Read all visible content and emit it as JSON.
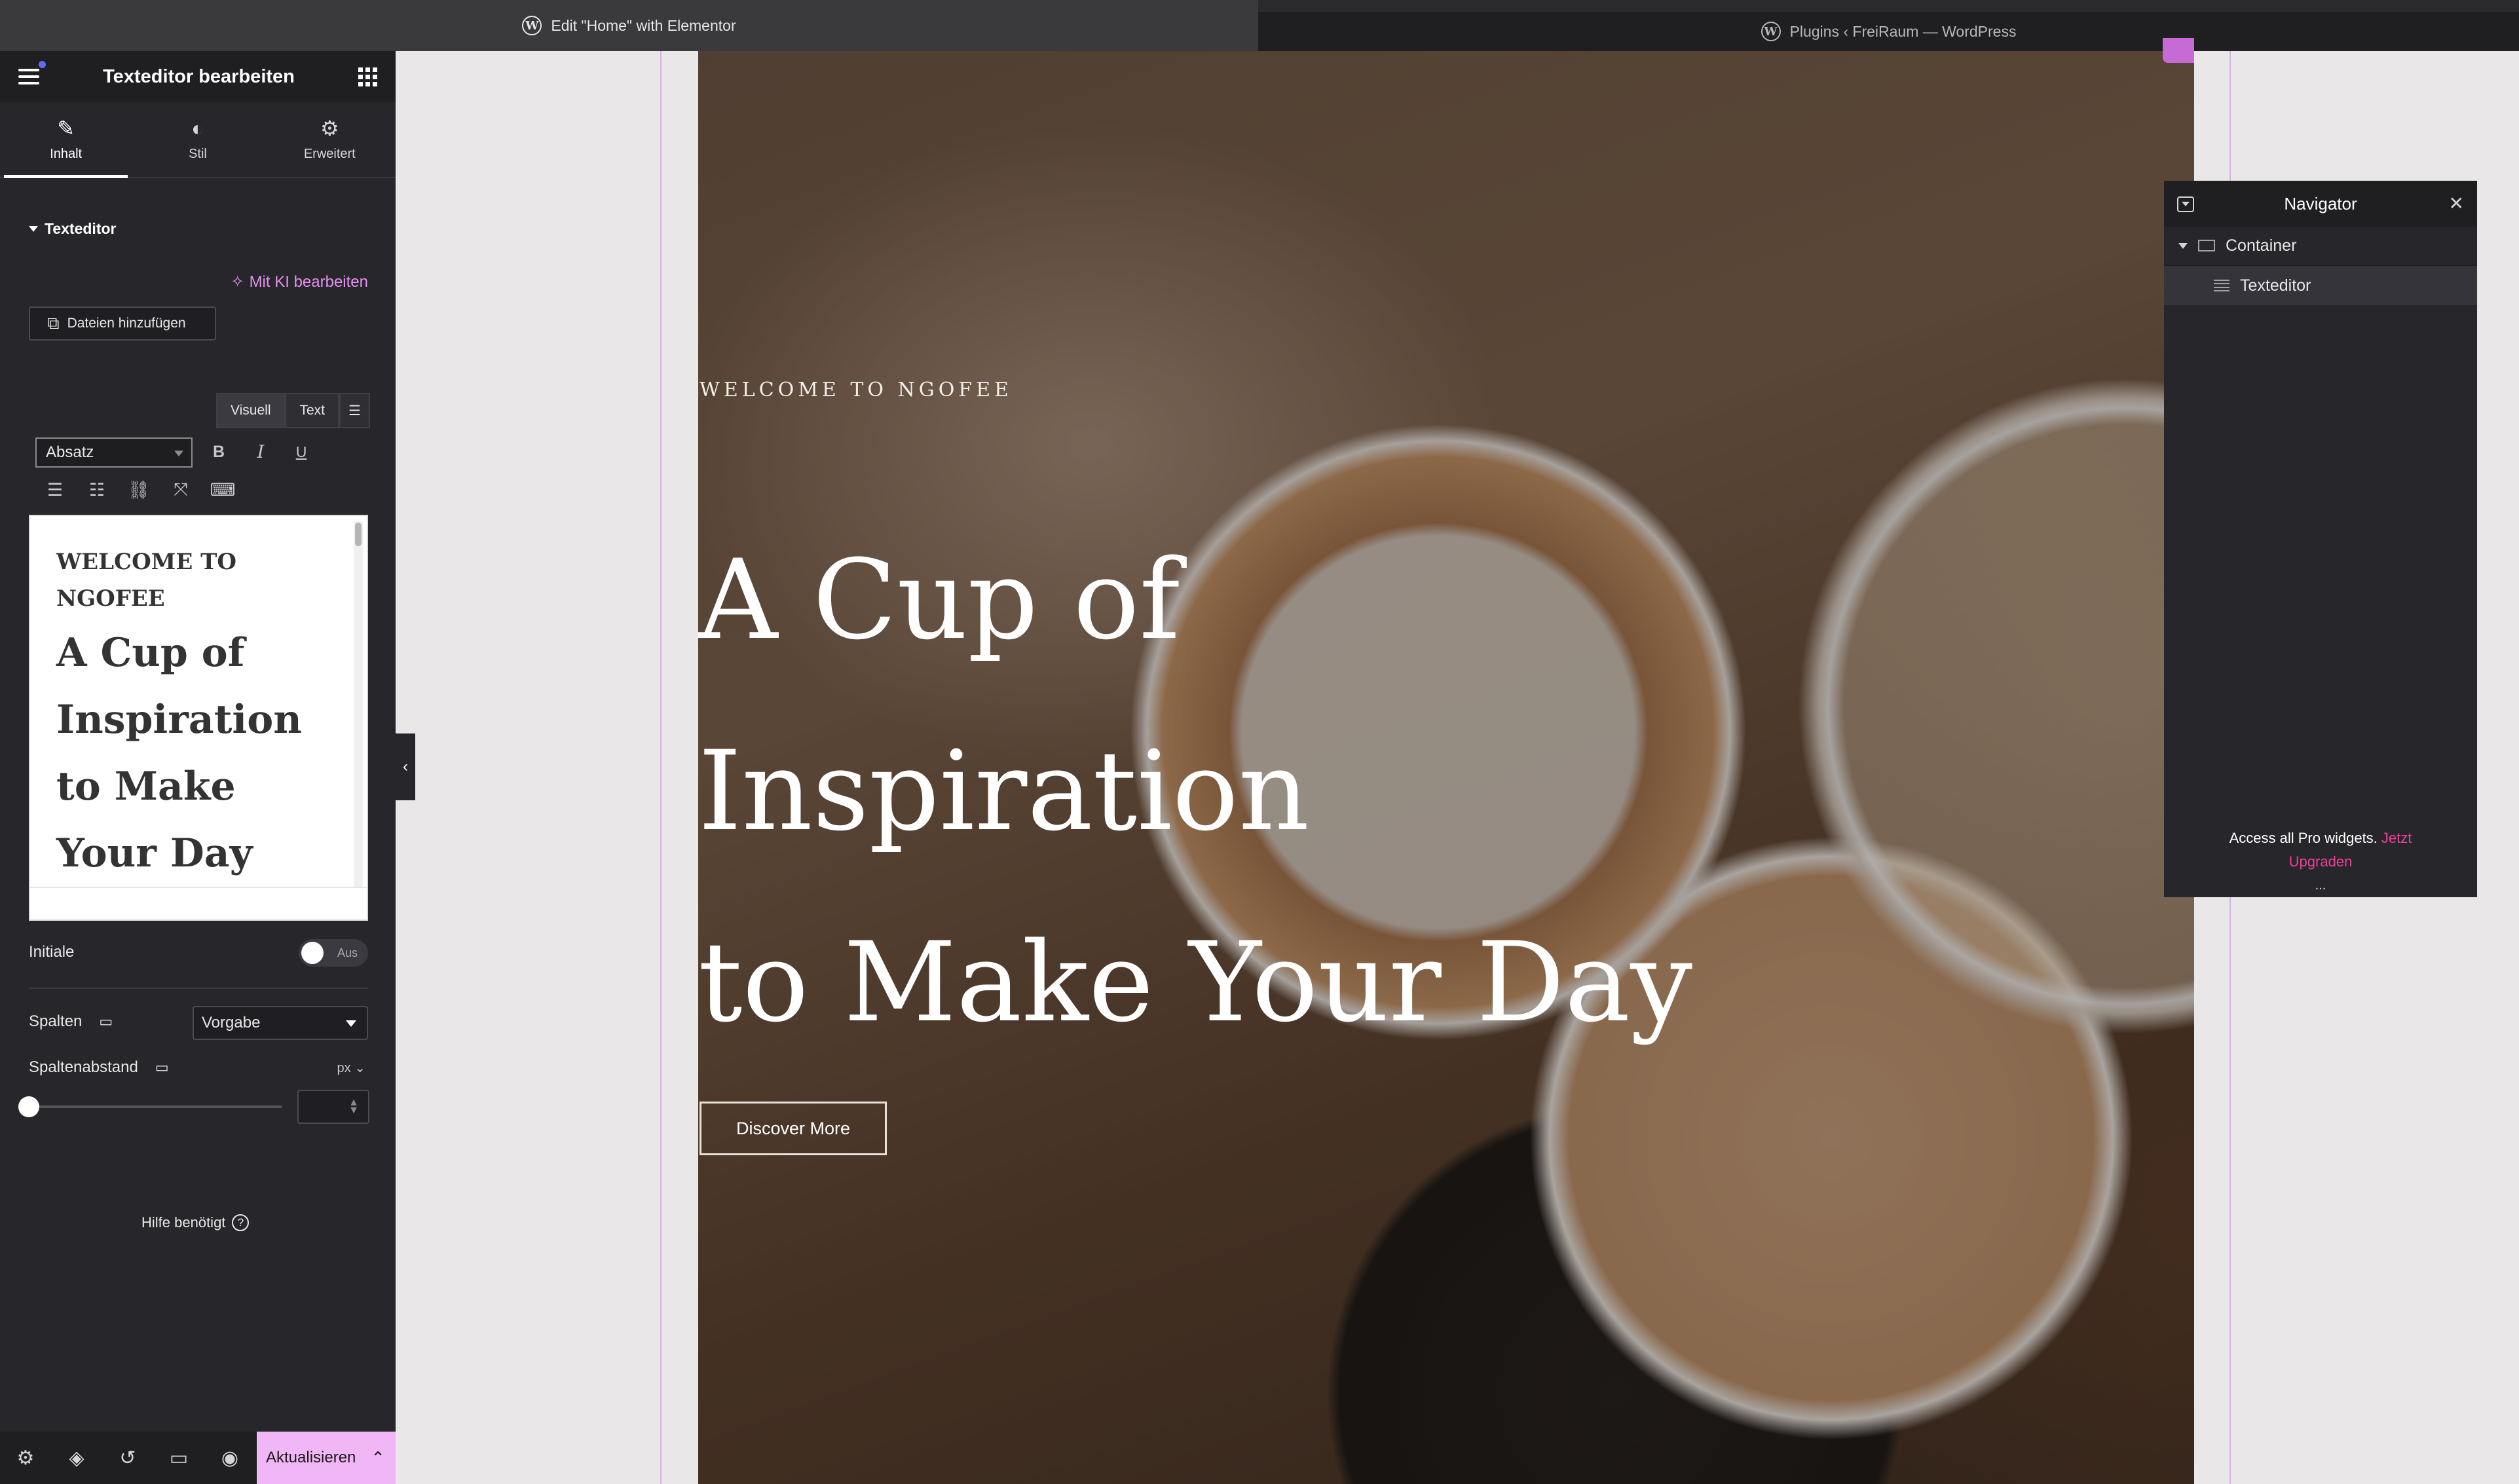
{
  "browser": {
    "tabs": [
      {
        "label": "Edit \"Home\" with Elementor",
        "active": true
      },
      {
        "label": "Plugins ‹ FreiRaum — WordPress",
        "active": false
      }
    ]
  },
  "panel": {
    "title": "Texteditor bearbeiten",
    "tabs": [
      {
        "label": "Inhalt",
        "icon": "pencil-icon",
        "active": true
      },
      {
        "label": "Stil",
        "icon": "contrast-icon",
        "active": false
      },
      {
        "label": "Erweitert",
        "icon": "gear-icon",
        "active": false
      }
    ],
    "section_title": "Texteditor",
    "ai_edit": "Mit KI bearbeiten",
    "add_files": "Dateien hinzufügen",
    "editor_tabs": [
      "Visuell",
      "Text"
    ],
    "format_select": "Absatz",
    "editor_content": {
      "welcome": "WELCOME TO NGOFEE",
      "heading": "A Cup of Inspiration to Make Your Day"
    },
    "initiale": {
      "label": "Initiale",
      "toggle_label": "Aus",
      "on": false
    },
    "spalten": {
      "label": "Spalten",
      "value": "Vorgabe"
    },
    "spaltenabstand": {
      "label": "Spaltenabstand",
      "unit": "px",
      "value": ""
    },
    "help": "Hilfe benötigt",
    "update_button": "Aktualisieren"
  },
  "canvas": {
    "welcome": "WELCOME TO NGOFEE",
    "title_lines": [
      "A Cup of",
      "Inspiration",
      "to Make Your Day"
    ],
    "button": "Discover More"
  },
  "navigator": {
    "title": "Navigator",
    "items": [
      {
        "label": "Container",
        "icon": "container-icon"
      },
      {
        "label": "Texteditor",
        "icon": "text-editor-icon"
      }
    ],
    "pro_text": "Access all Pro widgets.",
    "pro_link_1": "Jetzt",
    "pro_link_2": "Upgraden",
    "more": "..."
  },
  "colors": {
    "panel_bg": "#27272b",
    "accent_pink": "#f0b6f5",
    "upgrade_link": "#e9419a",
    "ai_link": "#e58ff0"
  }
}
